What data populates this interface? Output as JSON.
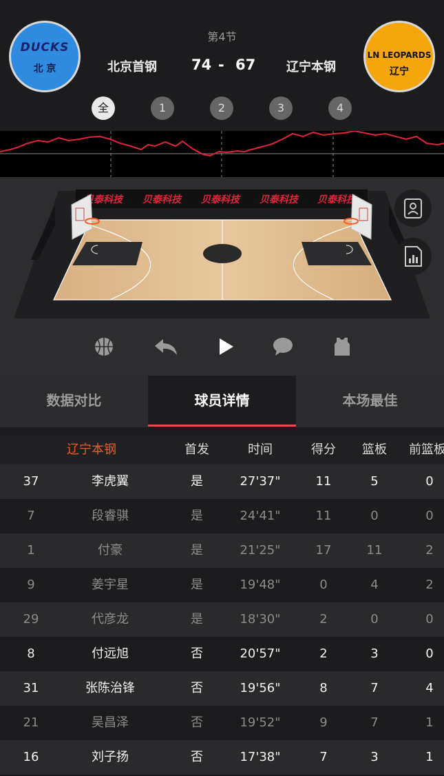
{
  "header": {
    "period": "第4节",
    "home_team": "北京首钢",
    "away_team": "辽宁本钢",
    "home_score": "74",
    "separator": "-",
    "away_score": "67",
    "home_logo_text": "DUCKS",
    "home_logo_sub": "北 京",
    "away_logo_text": "LN LEOPARDS",
    "away_logo_sub": "辽宁",
    "home_logo_color": "#2e8be0",
    "away_logo_color": "#f4a60a"
  },
  "quarters": [
    {
      "label": "全",
      "active": true
    },
    {
      "label": "1",
      "active": false
    },
    {
      "label": "2",
      "active": false
    },
    {
      "label": "3",
      "active": false
    },
    {
      "label": "4",
      "active": false
    }
  ],
  "court": {
    "ad_banner": [
      "贝泰科技",
      "贝泰科技",
      "贝泰科技",
      "贝泰科技",
      "贝泰科技"
    ]
  },
  "controls": [
    "basketball-icon",
    "reply-icon",
    "play-icon",
    "comment-icon",
    "jersey-icon"
  ],
  "tabs": [
    {
      "label": "数据对比",
      "active": false
    },
    {
      "label": "球员详情",
      "active": true
    },
    {
      "label": "本场最佳",
      "active": false
    }
  ],
  "table": {
    "headers": [
      "辽宁本钢",
      "首发",
      "时间",
      "得分",
      "篮板",
      "前篮板"
    ],
    "rows": [
      {
        "num": "37",
        "name": "李虎翼",
        "starter": "是",
        "time": "27'37\"",
        "pts": "11",
        "reb": "5",
        "oreb": "0",
        "dim": false
      },
      {
        "num": "7",
        "name": "段睿骐",
        "starter": "是",
        "time": "24'41\"",
        "pts": "11",
        "reb": "0",
        "oreb": "0",
        "dim": true
      },
      {
        "num": "1",
        "name": "付豪",
        "starter": "是",
        "time": "21'25\"",
        "pts": "17",
        "reb": "11",
        "oreb": "2",
        "dim": true
      },
      {
        "num": "9",
        "name": "姜宇星",
        "starter": "是",
        "time": "19'48\"",
        "pts": "0",
        "reb": "4",
        "oreb": "2",
        "dim": true
      },
      {
        "num": "29",
        "name": "代彦龙",
        "starter": "是",
        "time": "18'30\"",
        "pts": "2",
        "reb": "0",
        "oreb": "0",
        "dim": true
      },
      {
        "num": "8",
        "name": "付远旭",
        "starter": "否",
        "time": "20'57\"",
        "pts": "2",
        "reb": "3",
        "oreb": "0",
        "dim": false
      },
      {
        "num": "31",
        "name": "张陈治锋",
        "starter": "否",
        "time": "19'56\"",
        "pts": "8",
        "reb": "7",
        "oreb": "4",
        "dim": false
      },
      {
        "num": "21",
        "name": "吴昌泽",
        "starter": "否",
        "time": "19'52\"",
        "pts": "9",
        "reb": "7",
        "oreb": "1",
        "dim": true
      },
      {
        "num": "16",
        "name": "刘子扬",
        "starter": "否",
        "time": "17'38\"",
        "pts": "7",
        "reb": "3",
        "oreb": "1",
        "dim": false
      }
    ]
  },
  "colors": {
    "accent_team": "#f05a28",
    "tab_underline": "#e84a55",
    "momentum_line": "#e0243c"
  }
}
